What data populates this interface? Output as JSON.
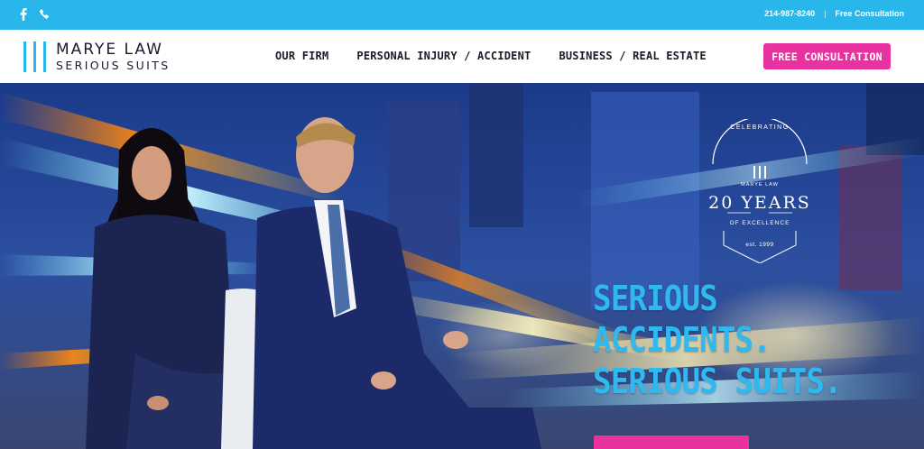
{
  "topbar": {
    "phone": "214-987-8240",
    "separator": "|",
    "consult_link": "Free Consultation",
    "icons": [
      "facebook-icon",
      "phone-icon"
    ]
  },
  "header": {
    "logo_line1": "MARYE LAW",
    "logo_line2": "SERIOUS SUITS",
    "nav": [
      "OUR FIRM",
      "PERSONAL INJURY / ACCIDENT",
      "BUSINESS / REAL ESTATE"
    ],
    "cta_label": "FREE CONSULTATION"
  },
  "hero": {
    "badge": {
      "celebrating": "CELEBRATING",
      "brand": "MARYE LAW",
      "years": "20 YEARS",
      "tagline": "OF EXCELLENCE",
      "est": "est. 1999"
    },
    "headline": [
      "SERIOUS",
      "ACCIDENTS.",
      "SERIOUS SUITS."
    ]
  },
  "colors": {
    "accent_blue": "#29b6ea",
    "accent_pink": "#e8329f",
    "navy": "#1b2250"
  }
}
